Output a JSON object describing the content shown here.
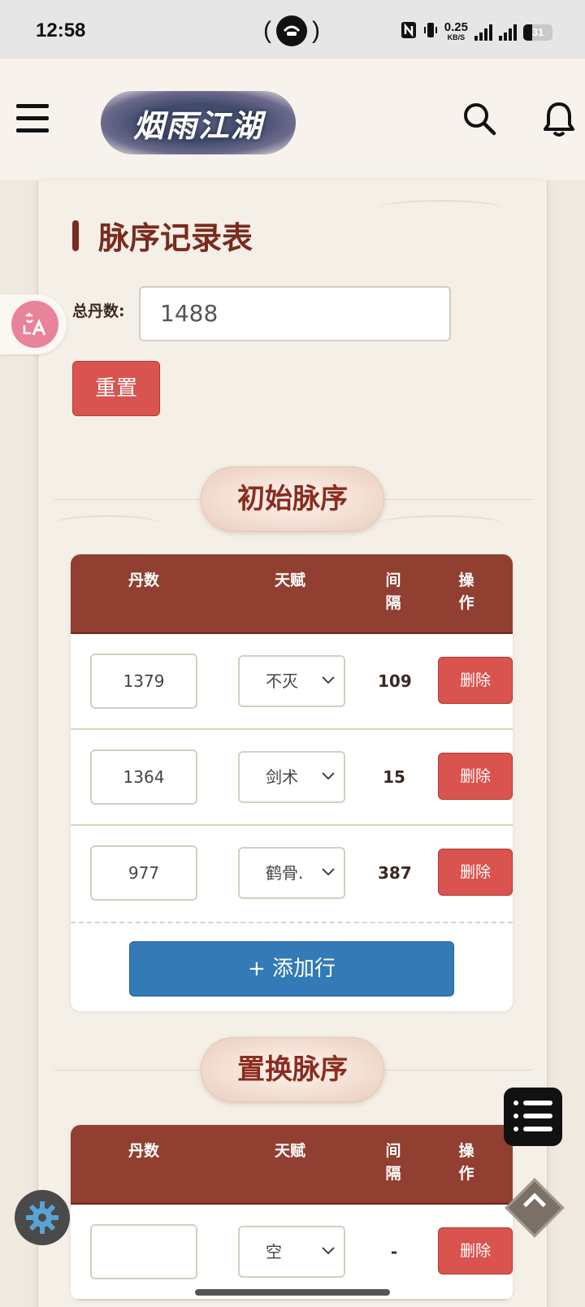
{
  "status_bar": {
    "time": "12:58",
    "net_speed": "0.25",
    "net_unit": "KB/S",
    "battery": "31"
  },
  "header": {
    "logo_text": "烟雨江湖"
  },
  "page": {
    "title": "脉序记录表",
    "total_label": "总丹数:",
    "total_value": "1488",
    "reset_label": "重置"
  },
  "sections": [
    {
      "title": "初始脉序",
      "columns": [
        "丹数",
        "天赋",
        "间\n隔",
        "操\n作"
      ],
      "rows": [
        {
          "dan": "1379",
          "tianfu": "不灭",
          "gap": "109",
          "action": "删除"
        },
        {
          "dan": "1364",
          "tianfu": "剑术",
          "gap": "15",
          "action": "删除"
        },
        {
          "dan": "977",
          "tianfu": "鹤骨.",
          "gap": "387",
          "action": "删除"
        }
      ],
      "add_label": "+ 添加行"
    },
    {
      "title": "置换脉序",
      "columns": [
        "丹数",
        "天赋",
        "间\n隔",
        "操\n作"
      ],
      "rows": [
        {
          "dan": "",
          "tianfu": "空",
          "gap": "-",
          "action": "删除"
        }
      ]
    }
  ],
  "floating": {
    "translate_icon": "translate-icon",
    "list_icon": "list-icon",
    "gear_icon": "gear-icon",
    "scroll_top_icon": "chevron-up-icon"
  },
  "colors": {
    "accent": "#913f30",
    "danger": "#d9534f",
    "primary": "#337ab7",
    "title": "#7a2b1e"
  }
}
